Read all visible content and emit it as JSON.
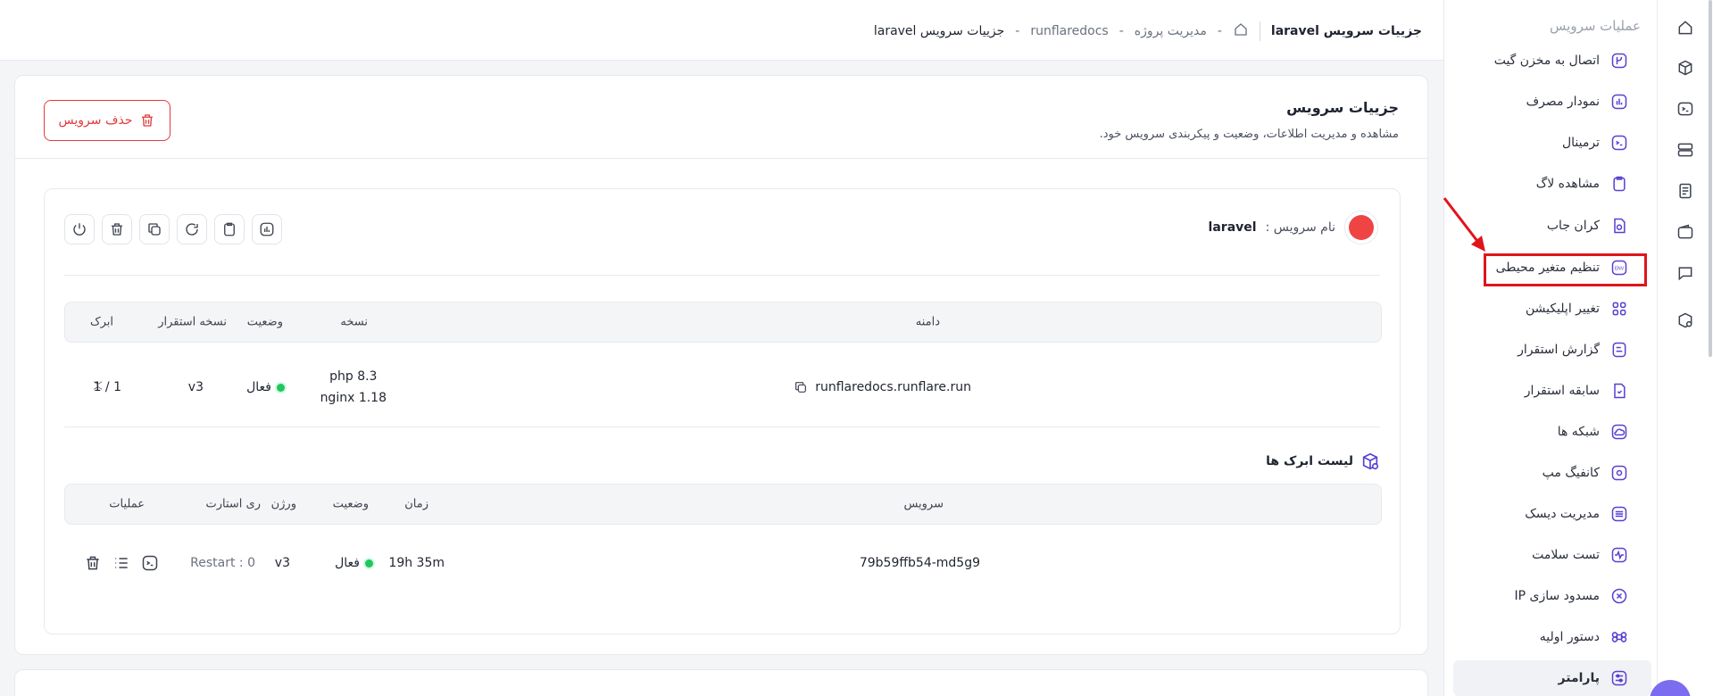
{
  "breadcrumb": {
    "page_title": "جزییات سرویس laravel",
    "items": [
      "مدیریت پروژه",
      "runflaredocs",
      "جزییات سرویس laravel"
    ],
    "separator": "-"
  },
  "sidebar": {
    "section_title": "عملیات سرویس",
    "items": [
      {
        "label": "اتصال به مخزن گیت",
        "icon": "git-branch-icon"
      },
      {
        "label": "نمودار مصرف",
        "icon": "chart-icon"
      },
      {
        "label": "ترمینال",
        "icon": "terminal-icon"
      },
      {
        "label": "مشاهده لاگ",
        "icon": "clipboard-icon"
      },
      {
        "label": "کران جاب",
        "icon": "clock-file-icon"
      },
      {
        "label": "تنظیم متغیر محیطی",
        "icon": "env-icon"
      },
      {
        "label": "تغییر اپلیکیشن",
        "icon": "apps-icon"
      },
      {
        "label": "گزارش استقرار",
        "icon": "report-icon"
      },
      {
        "label": "سابقه استقرار",
        "icon": "history-icon"
      },
      {
        "label": "شبکه ها",
        "icon": "cloud-icon"
      },
      {
        "label": "کانفیگ مپ",
        "icon": "gear-icon"
      },
      {
        "label": "مدیریت دیسک",
        "icon": "disk-icon"
      },
      {
        "label": "تست سلامت",
        "icon": "pulse-icon"
      },
      {
        "label": "مسدود سازی IP",
        "icon": "block-icon"
      },
      {
        "label": "دستور اولیه",
        "icon": "command-icon"
      },
      {
        "label": "پارامتر",
        "icon": "sliders-icon"
      }
    ]
  },
  "card": {
    "title": "جزییات سرویس",
    "subtitle": "مشاهده و مدیریت اطلاعات، وضعیت و پیکربندی سرویس خود.",
    "delete_label": "حذف سرویس"
  },
  "service": {
    "name_label": "نام سرویس :",
    "name_value": "laravel"
  },
  "deploy_table": {
    "headers": {
      "domain": "دامنه",
      "version": "نسخه",
      "status": "وضعیت",
      "deploy_version": "نسخه استقرار",
      "cloud": "ابرک"
    },
    "row": {
      "domain": "runflaredocs.runflare.run",
      "version_line1": "php 8.3",
      "version_line2": "nginx 1.18",
      "status": "فعال",
      "deploy_version": "v3",
      "cloud": "1 / 1"
    }
  },
  "pods": {
    "title": "لیست ابرک ها",
    "headers": {
      "service": "سرویس",
      "time": "زمان",
      "status": "وضعیت",
      "version": "ورژن",
      "restarts": "ری استارت",
      "ops": "عملیات"
    },
    "row": {
      "service": "79b59ffb54-md5g9",
      "time": "19h 35m",
      "status": "فعال",
      "version": "v3",
      "restarts": "Restart : 0"
    }
  },
  "colors": {
    "accent": "#5a3fd0",
    "danger": "#e23b3b",
    "highlight": "#e0141b",
    "success": "#22c55e"
  }
}
